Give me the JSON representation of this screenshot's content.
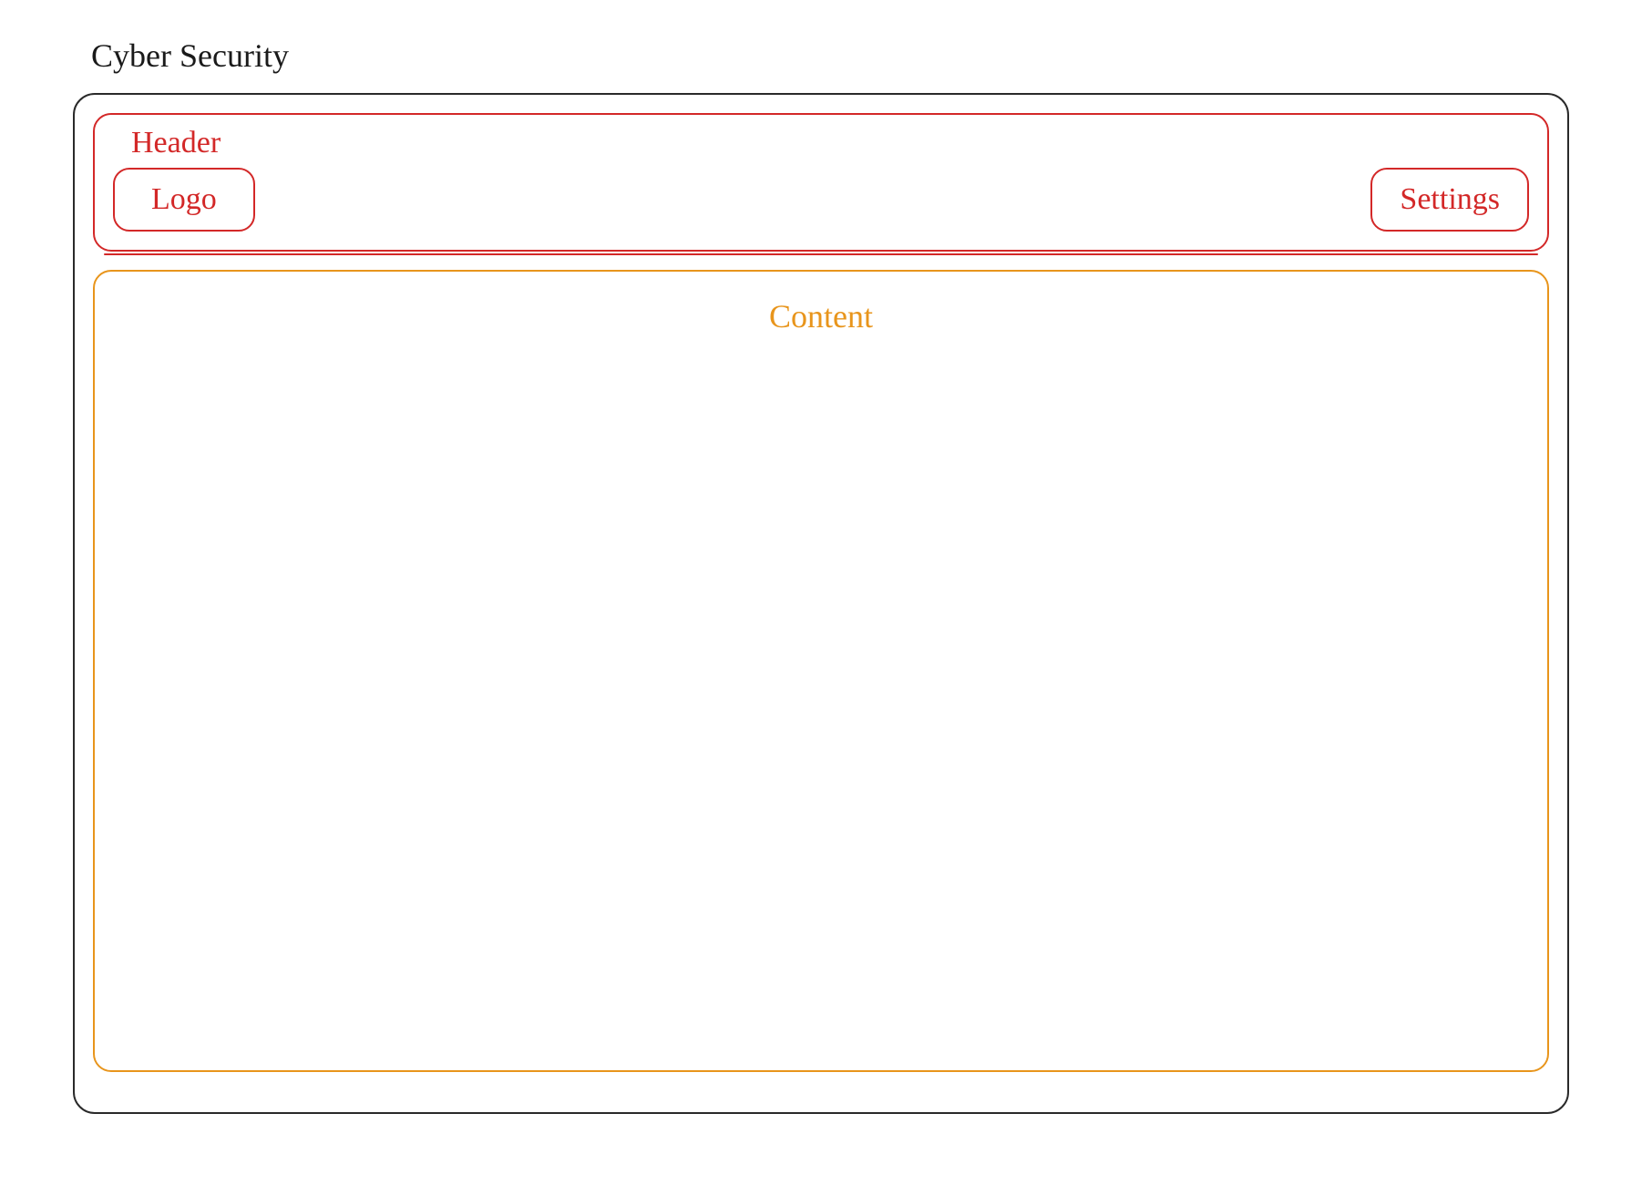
{
  "page": {
    "title": "Cyber Security"
  },
  "header": {
    "label": "Header",
    "logo": "Logo",
    "settings": "Settings"
  },
  "content": {
    "label": "Content"
  }
}
